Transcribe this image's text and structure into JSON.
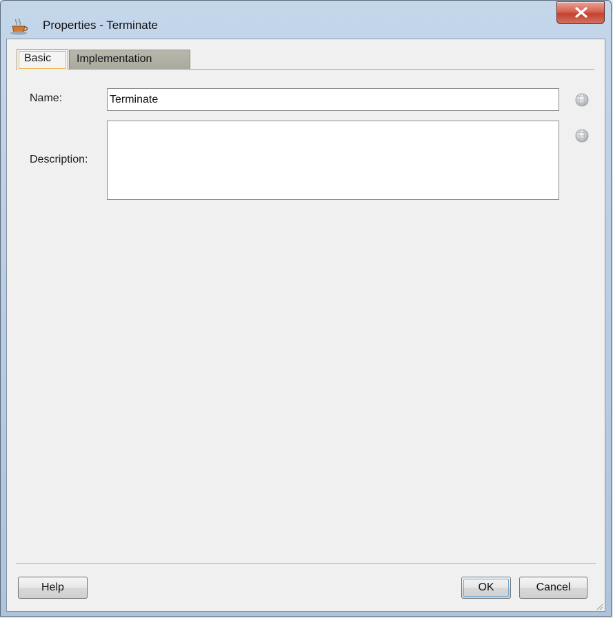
{
  "window": {
    "title": "Properties - Terminate",
    "close_icon": "close-icon",
    "app_icon": "coffee-cup-icon"
  },
  "tabs": [
    {
      "label": "Basic",
      "selected": true
    },
    {
      "label": "Implementation",
      "selected": false
    }
  ],
  "form": {
    "name_label": "Name:",
    "name_value": "Terminate",
    "description_label": "Description:",
    "description_value": "",
    "translate_icon": "globe-icon"
  },
  "buttons": {
    "help": "Help",
    "ok": "OK",
    "cancel": "Cancel"
  },
  "colors": {
    "close_button": "#c9483a",
    "selected_tab_outline": "#f0b44a",
    "inactive_tab": "#aeae a2",
    "dialog_background": "#f0f0f0"
  }
}
